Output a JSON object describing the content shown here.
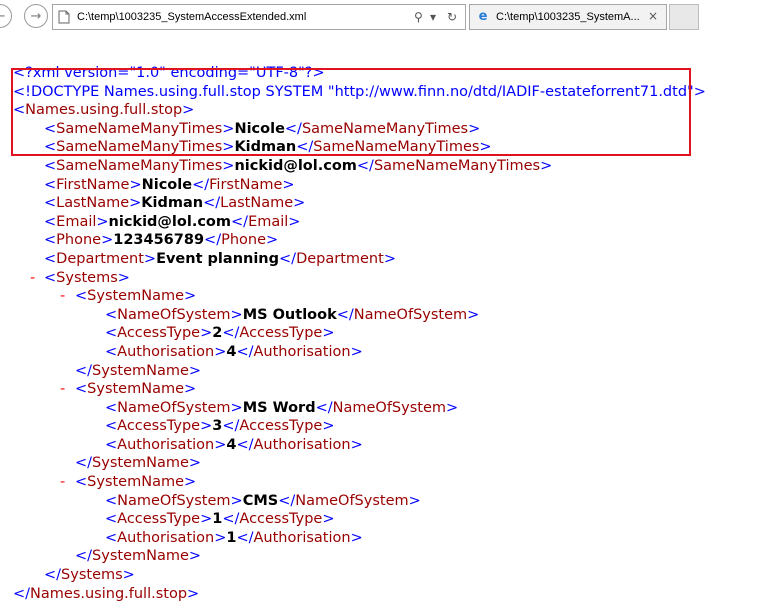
{
  "browser": {
    "address": "C:\\temp\\1003235_SystemAccessExtended.xml",
    "tab_title": "C:\\temp\\1003235_SystemA...",
    "tab_close": "×",
    "back_glyph": "←",
    "forward_glyph": "→",
    "search_glyph": "⚲",
    "dropdown_glyph": "▾",
    "refresh_glyph": "↻",
    "icons": [
      "back-icon",
      "forward-icon",
      "document-icon",
      "search-icon",
      "dropdown-icon",
      "refresh-icon",
      "ie-icon",
      "close-icon"
    ]
  },
  "xml": {
    "declaration": "<?xml version=\"1.0\" encoding=\"UTF-8\"?>",
    "doctype": "<!DOCTYPE Names.using.full.stop SYSTEM \"http://www.finn.no/dtd/IADIF-estateforrent71.dtd\">",
    "root_tag": "Names.using.full.stop",
    "same_tag": "SameNameManyTimes",
    "same_values": [
      "Nicole",
      "Kidman",
      "nickid@lol.com"
    ],
    "fields": [
      {
        "tag": "FirstName",
        "value": "Nicole"
      },
      {
        "tag": "LastName",
        "value": "Kidman"
      },
      {
        "tag": "Email",
        "value": "nickid@lol.com"
      },
      {
        "tag": "Phone",
        "value": "123456789"
      },
      {
        "tag": "Department",
        "value": "Event planning"
      }
    ],
    "collapse_glyph": "-",
    "systems_tag": "Systems",
    "system_tag": "SystemName",
    "name_tag": "NameOfSystem",
    "access_tag": "AccessType",
    "auth_tag": "Authorisation",
    "systems": [
      {
        "name": "MS Outlook",
        "access": "2",
        "auth": "4"
      },
      {
        "name": "MS Word",
        "access": "3",
        "auth": "4"
      },
      {
        "name": "CMS",
        "access": "1",
        "auth": "1"
      }
    ]
  },
  "highlight_color": "#e0141e"
}
